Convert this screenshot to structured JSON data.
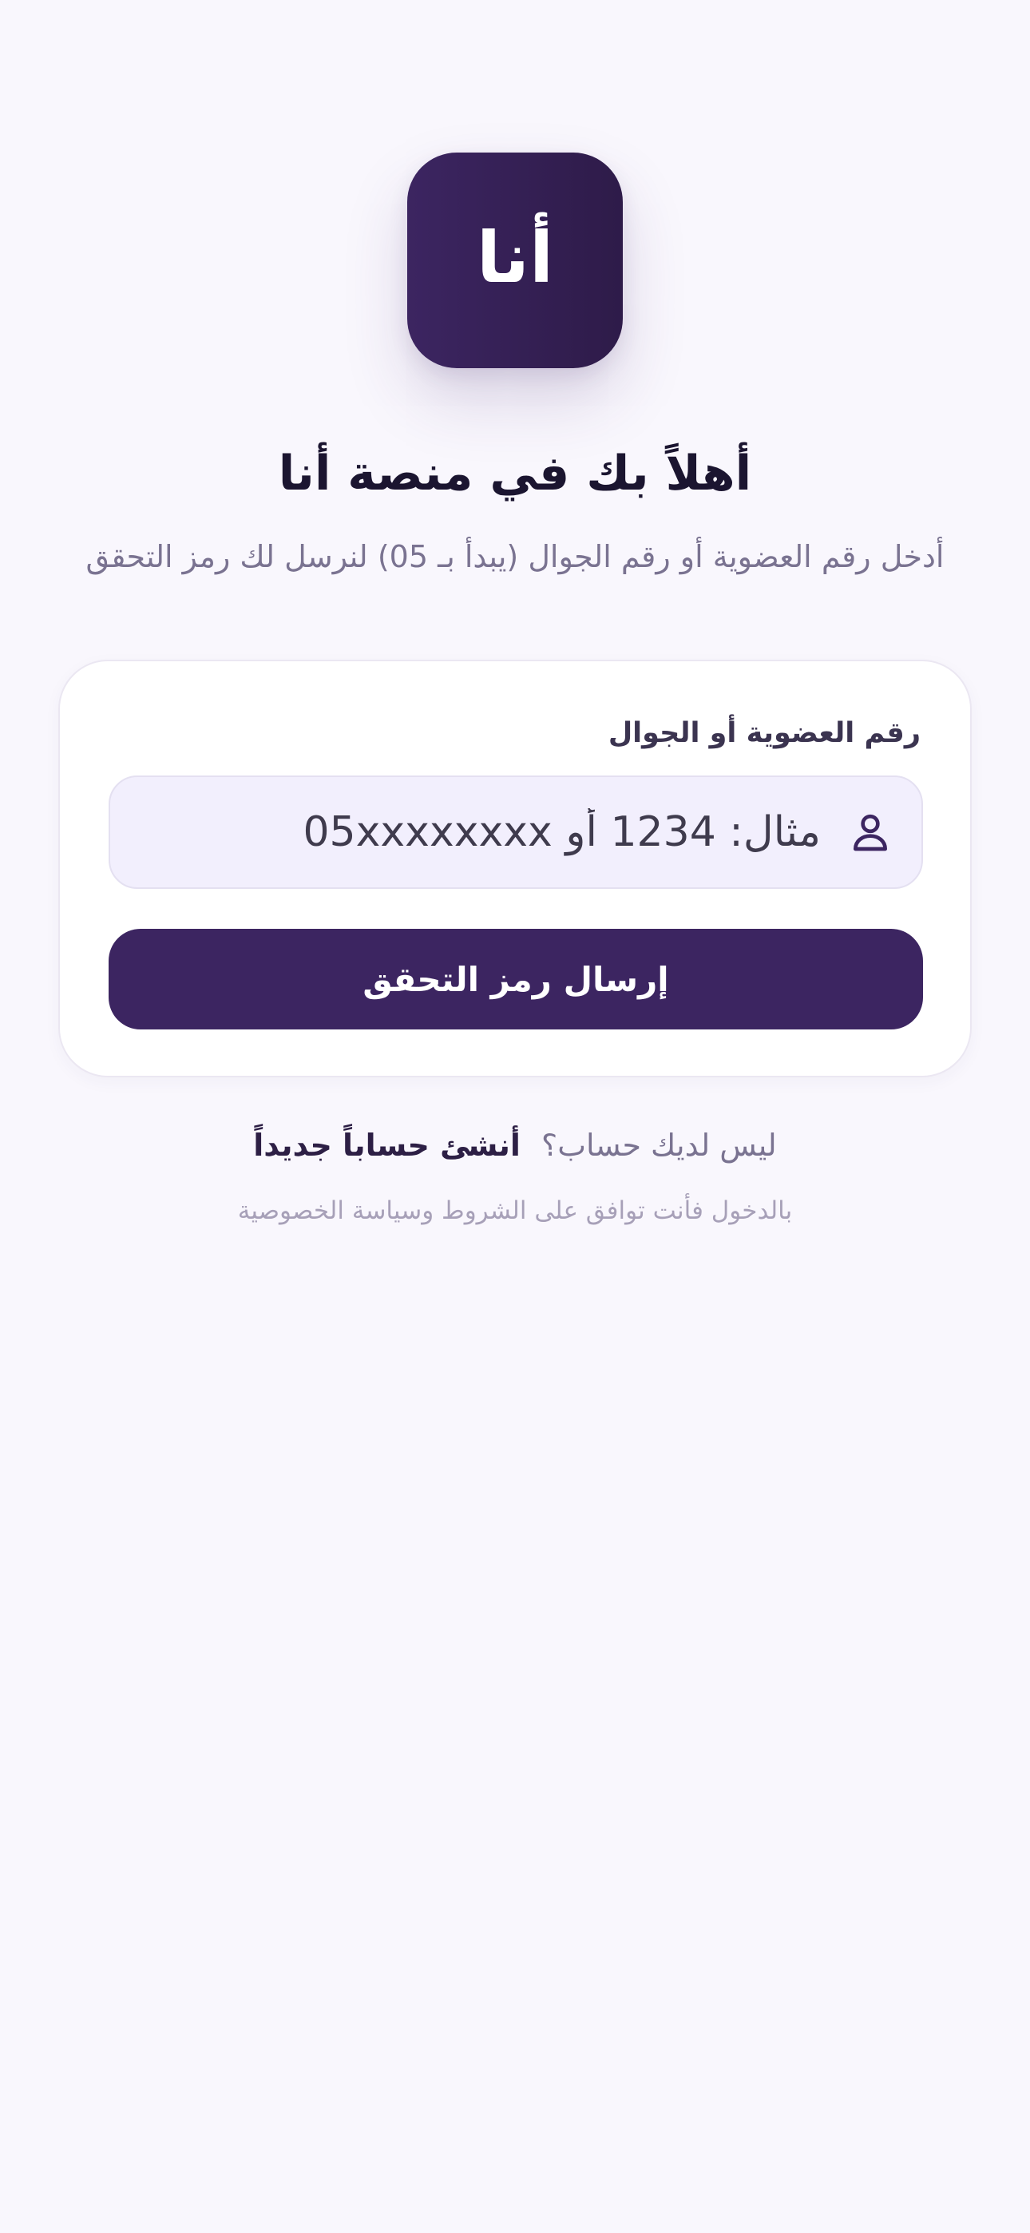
{
  "logo": {
    "text": "أنا"
  },
  "header": {
    "title": "أهلاً بك في منصة أنا",
    "subtitle": "أدخل رقم العضوية أو رقم الجوال (يبدأ بـ 05) لنرسل لك رمز التحقق"
  },
  "form": {
    "label": "رقم العضوية أو الجوال",
    "input_value": "",
    "input_placeholder": "مثال: 1234 أو 05xxxxxxxx",
    "submit_label": "إرسال رمز التحقق",
    "input_icon": "user-icon"
  },
  "footer": {
    "no_account_text": "ليس لديك حساب؟",
    "signup_link": "أنشئ حساباً جديداً",
    "terms_text": "بالدخول فأنت توافق على الشروط وسياسة الخصوصية"
  },
  "colors": {
    "background": "#f9f7fd",
    "primary": "#3c2561",
    "input_bg": "#f2effd",
    "muted_text": "#7a7391"
  }
}
